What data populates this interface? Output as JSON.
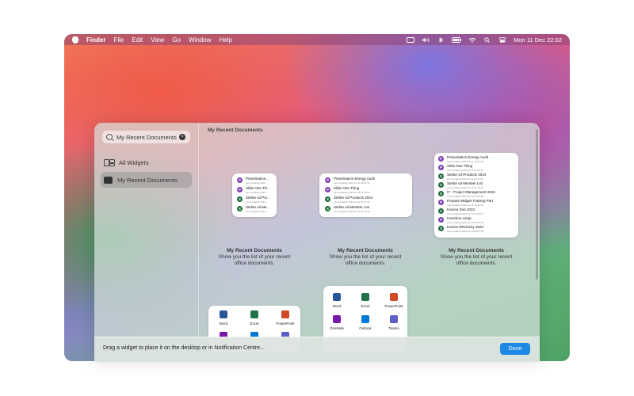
{
  "menubar": {
    "app_name": "Finder",
    "items": [
      "File",
      "Edit",
      "View",
      "Go",
      "Window",
      "Help"
    ],
    "datetime": "Mon 11 Dec  22:02"
  },
  "sidebar": {
    "search_value": "My Recent Documents",
    "items": [
      {
        "label": "All Widgets",
        "icon": "widgets-icon"
      },
      {
        "label": "My Recent Documents",
        "icon": "document-icon"
      }
    ]
  },
  "content": {
    "section_title": "My Recent Documents",
    "widgets": [
      {
        "rows": [
          {
            "app": "P",
            "title": "Presentation...",
            "sub": "Last updated 2023-..."
          },
          {
            "app": "P",
            "title": "Slide One Thi...",
            "sub": "Last updated 2023-..."
          },
          {
            "app": "X",
            "title": "Stefan vd Pro...",
            "sub": "Last updated 2023-..."
          },
          {
            "app": "X",
            "title": "Stefan vd Me...",
            "sub": "Last updated 2023-..."
          }
        ],
        "caption_title": "My Recent Documents",
        "caption_line1": "Show you the list of your recent",
        "caption_line2": "office documents."
      },
      {
        "rows": [
          {
            "app": "P",
            "title": "Presentation Energy Audit",
            "sub": "Last updated 2023-12-11 22:01:44"
          },
          {
            "app": "P",
            "title": "Slide One Thing",
            "sub": "Last updated 2023-12-11 21:58:12"
          },
          {
            "app": "X",
            "title": "Stefan vd Products 2024",
            "sub": "Last updated 2023-12-11 21:37:09"
          },
          {
            "app": "X",
            "title": "Stefan vd Member List",
            "sub": "Last updated 2023-12-11 21:15:26"
          }
        ],
        "caption_title": "My Recent Documents",
        "caption_line1": "Show you the list of your recent",
        "caption_line2": "office documents."
      },
      {
        "rows": [
          {
            "app": "P",
            "title": "Presentation Energy Audit",
            "sub": "Last updated 2023-12-11 22:01:44"
          },
          {
            "app": "P",
            "title": "Slide One Thing",
            "sub": "Last updated 2023-12-11 21:58:12"
          },
          {
            "app": "X",
            "title": "Stefan vd Products 2024",
            "sub": "Last updated 2023-12-11 21:37:09"
          },
          {
            "app": "X",
            "title": "Stefan vd Member List",
            "sub": "Last updated 2023-12-11 21:15:26"
          },
          {
            "app": "X",
            "title": "IT - Project Management 2024",
            "sub": "Last updated 2023-12-10 18:40:03"
          },
          {
            "app": "P",
            "title": "Prepare Widget Training Part",
            "sub": "Last updated 2023-12-10 15:22:51"
          },
          {
            "app": "X",
            "title": "Invoice Gas 2023",
            "sub": "Last updated 2023-12-09 11:05:37"
          },
          {
            "app": "P",
            "title": "Invention Lamp",
            "sub": "Last updated 2023-12-08 20:13:49"
          },
          {
            "app": "X",
            "title": "Invoice Electricity 2023",
            "sub": "Last updated 2023-12-08 09:47:18"
          }
        ],
        "caption_title": "My Recent Documents",
        "caption_line1": "Show you the list of your recent",
        "caption_line2": "office documents."
      }
    ],
    "app_widget_small": [
      "Word",
      "Excel",
      "PowerPoint"
    ],
    "app_widget_large": [
      {
        "label": "Word",
        "color": "#2b579a"
      },
      {
        "label": "Excel",
        "color": "#217346"
      },
      {
        "label": "PowerPoint",
        "color": "#d24726"
      },
      {
        "label": "OneNote",
        "color": "#7719aa"
      },
      {
        "label": "Outlook",
        "color": "#0078d4"
      },
      {
        "label": "Teams",
        "color": "#5b5fc7"
      }
    ]
  },
  "bottom": {
    "hint": "Drag a widget to place it on the desktop or in Notification Centre...",
    "done_label": "Done"
  },
  "colors": {
    "accent": "#1e88e5",
    "powerpoint": "#7a3fb0",
    "excel": "#1d6b3a"
  }
}
